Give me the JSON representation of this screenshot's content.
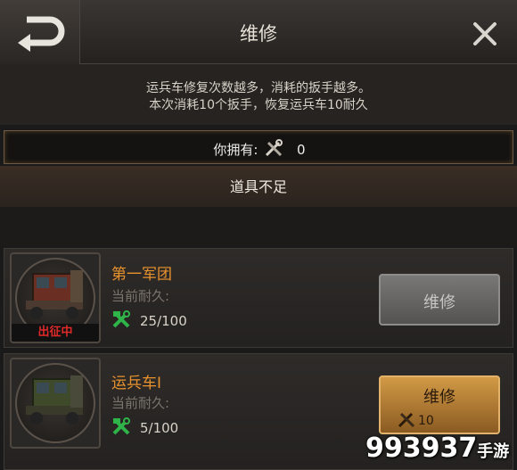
{
  "header": {
    "title": "维修",
    "back_icon": "back-arrow-icon",
    "close_icon": "close-icon"
  },
  "info": {
    "line1": "运兵车修复次数越多，消耗的扳手越多。",
    "line2": "本次消耗10个扳手，恢复运兵车10耐久"
  },
  "inventory": {
    "label": "你拥有:",
    "icon": "wrench-icon",
    "count": "0"
  },
  "warning": "道具不足",
  "units": [
    {
      "name": "第一军团",
      "durability_label": "当前耐久:",
      "durability": "25/100",
      "status": "出征中",
      "button_label": "维修",
      "colors": {
        "name": "#e8922e",
        "status": "#e02a2a"
      }
    },
    {
      "name": "运兵车I",
      "durability_label": "当前耐久:",
      "durability": "5/100",
      "button_label": "维修",
      "cost": "10"
    }
  ],
  "watermark": {
    "text": "993937",
    "suffix": "手游"
  },
  "colors": {
    "accent": "#e8922e",
    "button_gold": "#d29a46",
    "button_gray": "#6a6866"
  }
}
